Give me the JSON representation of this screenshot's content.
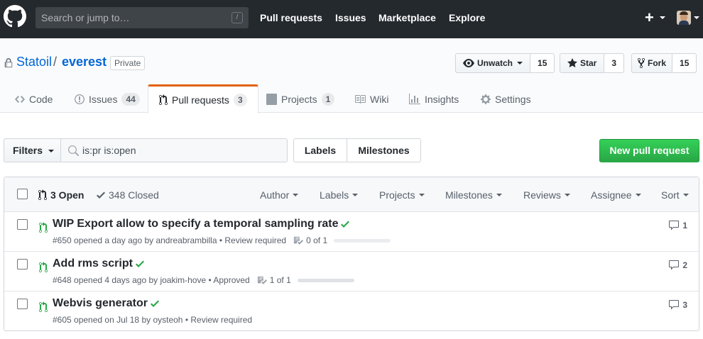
{
  "header": {
    "search_placeholder": "Search or jump to…",
    "search_key": "/",
    "nav": [
      "Pull requests",
      "Issues",
      "Marketplace",
      "Explore"
    ],
    "plus": "+"
  },
  "repo": {
    "owner": "Statoil",
    "slash": "/",
    "name": "everest",
    "visibility": "Private",
    "watch": {
      "label": "Unwatch",
      "count": "15"
    },
    "star": {
      "label": "Star",
      "count": "3"
    },
    "fork": {
      "label": "Fork",
      "count": "15"
    }
  },
  "tabs": [
    {
      "label": "Code",
      "icon": "code-icon"
    },
    {
      "label": "Issues",
      "count": "44",
      "icon": "issue-icon"
    },
    {
      "label": "Pull requests",
      "count": "3",
      "icon": "git-pull-request-icon",
      "selected": true
    },
    {
      "label": "Projects",
      "count": "1",
      "icon": "project-icon"
    },
    {
      "label": "Wiki",
      "icon": "book-icon"
    },
    {
      "label": "Insights",
      "icon": "graph-icon"
    },
    {
      "label": "Settings",
      "icon": "gear-icon"
    }
  ],
  "subnav": {
    "filters": "Filters",
    "query": "is:pr is:open",
    "labels": "Labels",
    "milestones": "Milestones",
    "new_pr": "New pull request"
  },
  "list_header": {
    "open": "3 Open",
    "closed": "348 Closed",
    "menus": [
      "Author",
      "Labels",
      "Projects",
      "Milestones",
      "Reviews",
      "Assignee",
      "Sort"
    ]
  },
  "pulls": [
    {
      "title": "WIP Export allow to specify a temporal sampling rate",
      "meta": "#650 opened a day ago by andreabrambilla • Review required",
      "tasks": "0 of 1",
      "progress": 0,
      "comments": "1"
    },
    {
      "title": "Add rms script",
      "meta": "#648 opened 4 days ago by joakim-hove • Approved",
      "tasks": "1 of 1",
      "progress": 1,
      "comments": "2"
    },
    {
      "title": "Webvis generator",
      "meta": "#605 opened on Jul 18 by oysteoh • Review required",
      "tasks": "",
      "progress": null,
      "comments": "3"
    }
  ],
  "colors": {
    "header_bg": "#24292e",
    "link": "#0366d6",
    "success": "#28a745",
    "tab_accent": "#e36209"
  }
}
